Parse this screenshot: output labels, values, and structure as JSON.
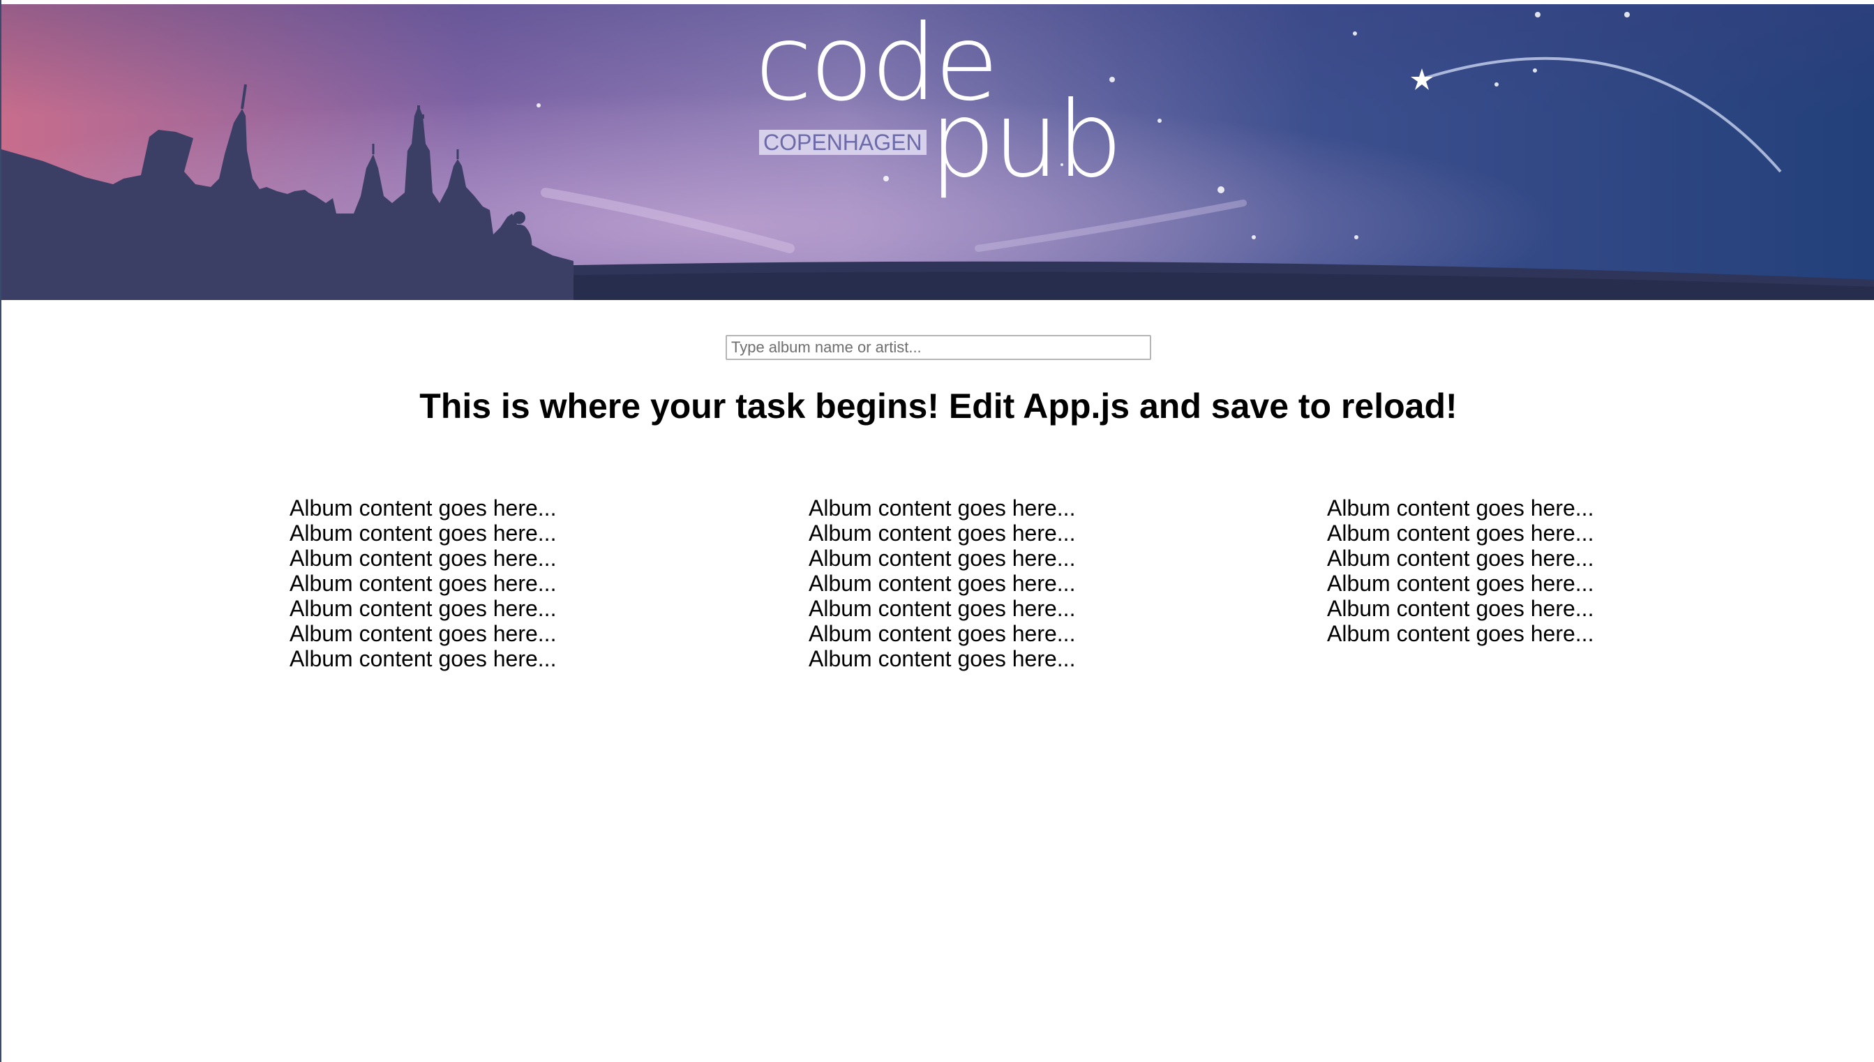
{
  "header": {
    "logo": {
      "word_top": "code",
      "word_bottom": "pub",
      "badge": "COPENHAGEN"
    },
    "colors": {
      "sky_left": "#c86d8c",
      "sky_mid": "#7a64a6",
      "sky_right": "#23407a",
      "skyline": "#3b3f66"
    }
  },
  "search": {
    "placeholder": "Type album name or artist...",
    "value": ""
  },
  "main": {
    "heading": "This is where your task begins! Edit App.js and save to reload!"
  },
  "albums": {
    "columns": [
      {
        "items": [
          "Album content goes here...",
          "Album content goes here...",
          "Album content goes here...",
          "Album content goes here...",
          "Album content goes here...",
          "Album content goes here...",
          "Album content goes here..."
        ]
      },
      {
        "items": [
          "Album content goes here...",
          "Album content goes here...",
          "Album content goes here...",
          "Album content goes here...",
          "Album content goes here...",
          "Album content goes here...",
          "Album content goes here..."
        ]
      },
      {
        "items": [
          "Album content goes here...",
          "Album content goes here...",
          "Album content goes here...",
          "Album content goes here...",
          "Album content goes here...",
          "Album content goes here..."
        ]
      }
    ]
  }
}
